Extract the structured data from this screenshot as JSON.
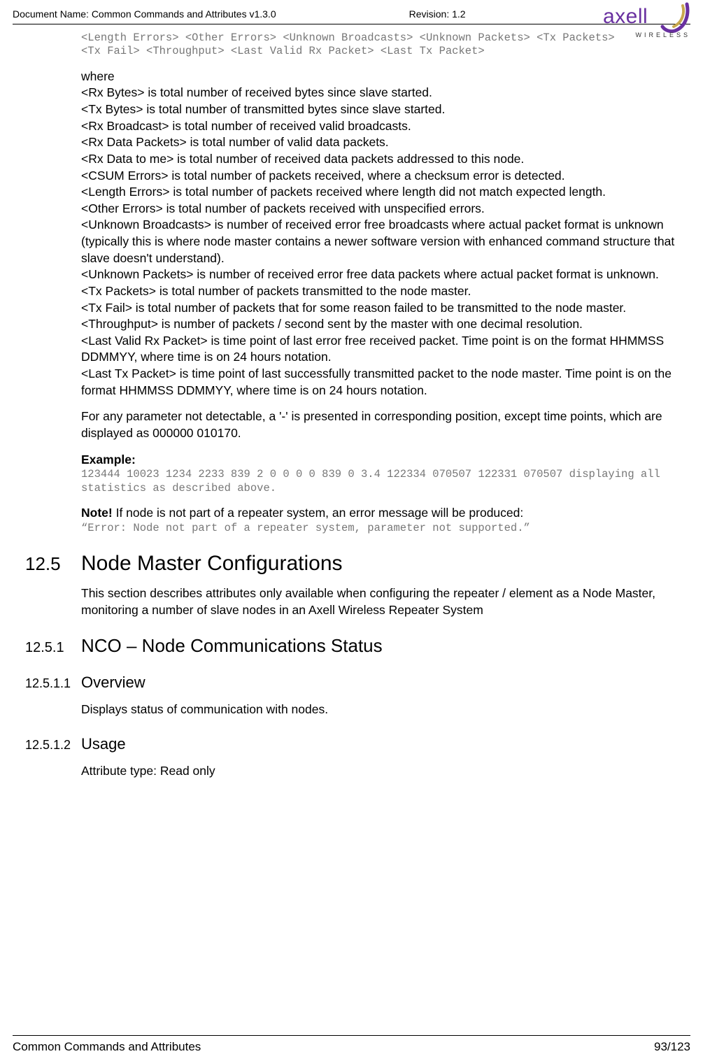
{
  "header": {
    "doc_name": "Document Name: Common Commands and Attributes v1.3.0",
    "revision": "Revision: 1.2",
    "logo_main": "axell",
    "logo_sub": "WIRELESS"
  },
  "code_top_line1": "<Length Errors> <Other Errors> <Unknown Broadcasts> <Unknown Packets> <Tx Packets>",
  "code_top_line2": "<Tx Fail> <Throughput> <Last Valid Rx Packet> <Last Tx Packet>",
  "where_label": "where",
  "defs": {
    "rx_bytes": "<Rx Bytes> is total number of received bytes since slave started.",
    "tx_bytes": "<Tx Bytes> is total number of transmitted bytes since slave started.",
    "rx_broadcast": "<Rx Broadcast> is total number of received valid broadcasts.",
    "rx_data_packets": "<Rx Data Packets> is total number of valid data packets.",
    "rx_data_to_me": "<Rx Data to me> is total number of received data packets addressed to this node.",
    "csum_errors": "<CSUM Errors> is total number of packets received, where a checksum error is detected.",
    "length_errors": "<Length Errors> is total number of packets received where length did not match expected length.",
    "other_errors": "<Other Errors> is total number of packets received with unspecified errors.",
    "unknown_broadcasts": "<Unknown Broadcasts> is number of received error free broadcasts where actual packet format is unknown (typically this is where node master contains a newer software version with enhanced command structure that slave doesn't understand).",
    "unknown_packets": "<Unknown Packets> is number of received error free data packets where actual packet format is unknown.",
    "tx_packets": "<Tx Packets> is total number of packets transmitted to the node master.",
    "tx_fail": "<Tx Fail> is total number of packets that for some reason failed to be transmitted to the node master.",
    "throughput": "<Throughput> is number of packets / second sent by the master with one decimal resolution.",
    "last_valid_rx": "<Last Valid Rx Packet> is time point of last error free received packet. Time point is on the format HHMMSS DDMMYY, where time is on 24 hours notation.",
    "last_tx": "<Last Tx Packet> is time point of last successfully transmitted packet to the node master.  Time point is on the format HHMMSS DDMMYY, where time is on 24 hours notation."
  },
  "not_detectable": "For any parameter not detectable, a '-' is presented in corresponding position, except time points, which are displayed as 000000 010170.",
  "example_label": "Example:",
  "example_code": "123444 10023 1234 2233 839 2 0 0 0 0 839 0 3.4 122334 070507 122331 070507 displaying all statistics as described above.",
  "note_bold": "Note!",
  "note_rest": " If node is not part of a repeater system, an error message will be produced:",
  "note_code": "“Error: Node not part of a repeater system, parameter not supported.”",
  "sections": {
    "s125_num": "12.5",
    "s125_title": "Node Master Configurations",
    "s125_body": "This section describes attributes only available when configuring the repeater / element as a Node Master, monitoring a number of slave nodes in an Axell Wireless Repeater System",
    "s1251_num": "12.5.1",
    "s1251_title": "NCO – Node Communications Status",
    "s12511_num": "12.5.1.1",
    "s12511_title": "Overview",
    "s12511_body": "Displays status of communication with nodes.",
    "s12512_num": "12.5.1.2",
    "s12512_title": "Usage",
    "s12512_body": "Attribute type: Read only"
  },
  "footer": {
    "left": "Common Commands and Attributes",
    "right": "93/123"
  }
}
